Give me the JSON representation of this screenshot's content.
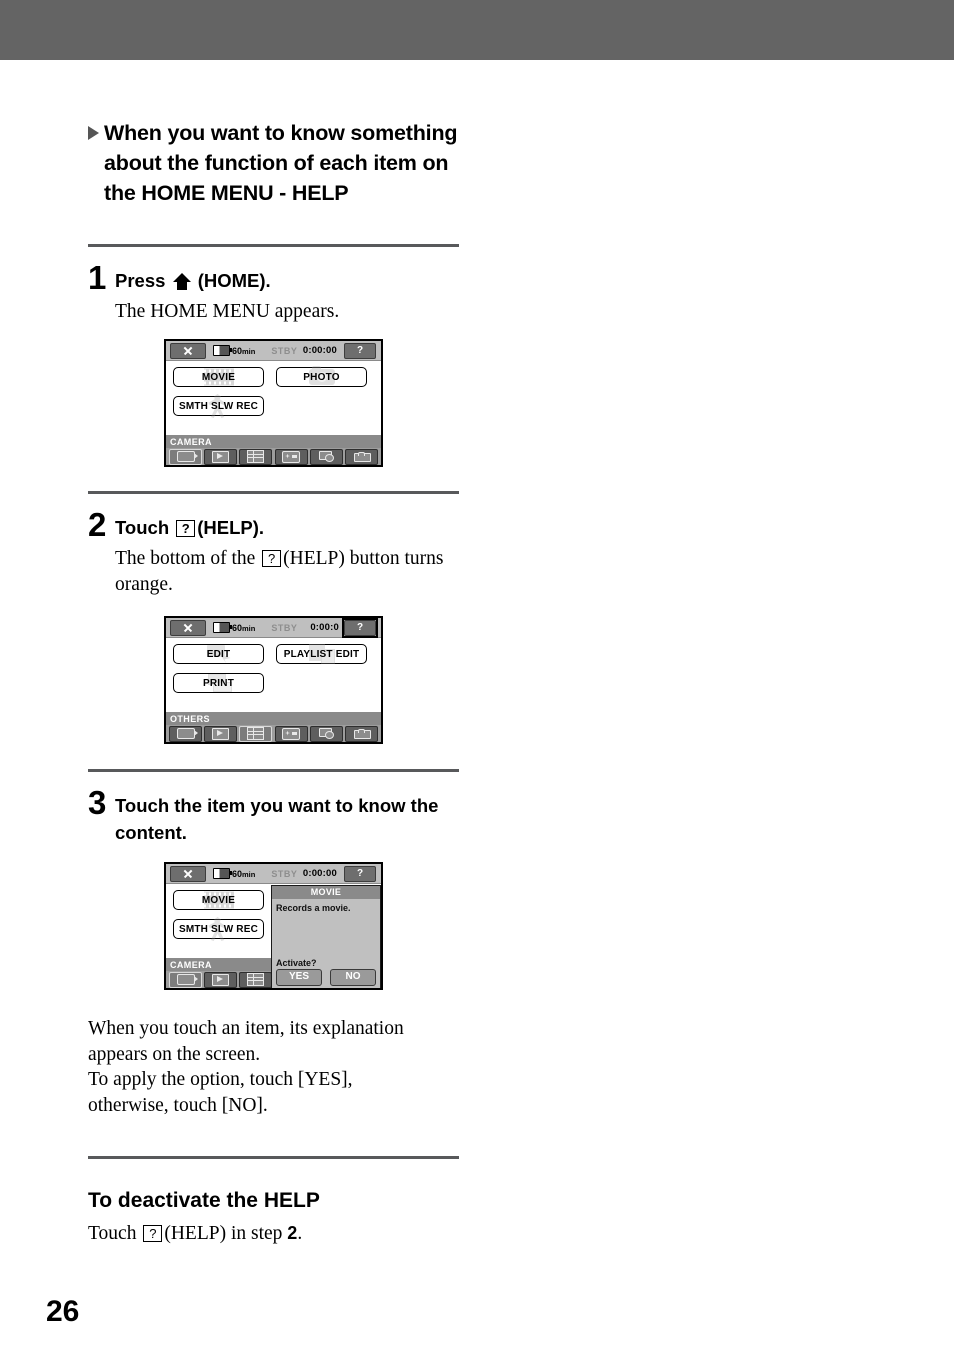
{
  "page": {
    "number": "26"
  },
  "section": {
    "heading": "When you want to know something about the function of each item on the HOME MENU - HELP"
  },
  "steps": [
    {
      "number": "1",
      "title_before": "Press",
      "title_after": "(HOME).",
      "icon": "home-icon",
      "subtext": "The HOME MENU appears."
    },
    {
      "number": "2",
      "title_before": "Touch",
      "title_after": "(HELP).",
      "icon": "help-icon",
      "subtext_before": "The bottom of the",
      "subtext_after": "(HELP) button turns orange."
    },
    {
      "number": "3",
      "title": "Touch the item you want to know the content."
    }
  ],
  "screens": {
    "screen1": {
      "status": {
        "close": "close-icon",
        "battery_icon": "battery-icon",
        "battery_value": "60",
        "battery_unit": "min",
        "mode": "STBY",
        "timecode": "0:00:00",
        "help": "?"
      },
      "options": [
        {
          "label": "MOVIE",
          "ghost": "film-icon"
        },
        {
          "label": "PHOTO",
          "ghost": "camera-icon"
        },
        {
          "label": "SMTH SLW REC",
          "ghost": "person-icon"
        }
      ],
      "category": "CAMERA",
      "tabs": [
        {
          "name": "camera-tab",
          "icon": "camcorder-icon",
          "active": true
        },
        {
          "name": "view-images-tab",
          "icon": "play-icon",
          "active": false
        },
        {
          "name": "others-tab",
          "icon": "list-icon",
          "active": false
        },
        {
          "name": "manage-media-tab",
          "icon": "media-icon",
          "active": false
        },
        {
          "name": "edit-tab",
          "icon": "edit-icon",
          "active": false
        },
        {
          "name": "settings-tab",
          "icon": "toolbox-icon",
          "active": false
        }
      ]
    },
    "screen2": {
      "status": {
        "close": "close-icon",
        "battery_icon": "battery-icon",
        "battery_value": "60",
        "battery_unit": "min",
        "mode": "STBY",
        "timecode": "0:00:0",
        "help": "?",
        "help_highlighted": true
      },
      "options": [
        {
          "label": "EDIT",
          "ghost": "edit-icon"
        },
        {
          "label": "PLAYLIST EDIT",
          "ghost": "playlist-icon"
        },
        {
          "label": "PRINT",
          "ghost": "printer-icon"
        }
      ],
      "category": "OTHERS",
      "tabs": [
        {
          "name": "camera-tab",
          "icon": "camcorder-icon",
          "active": false
        },
        {
          "name": "view-images-tab",
          "icon": "play-icon",
          "active": false
        },
        {
          "name": "others-tab",
          "icon": "list-icon",
          "active": true
        },
        {
          "name": "manage-media-tab",
          "icon": "media-icon",
          "active": false
        },
        {
          "name": "edit-tab",
          "icon": "edit-icon",
          "active": false
        },
        {
          "name": "settings-tab",
          "icon": "toolbox-icon",
          "active": false
        }
      ]
    },
    "screen3": {
      "status": {
        "close": "close-icon",
        "battery_icon": "battery-icon",
        "battery_value": "60",
        "battery_unit": "min",
        "mode": "STBY",
        "timecode": "0:00:00",
        "help": "?"
      },
      "options": [
        {
          "label": "MOVIE",
          "ghost": "film-icon"
        },
        {
          "label": "SMTH SLW REC",
          "ghost": "person-icon"
        }
      ],
      "category": "CAMERA",
      "popup": {
        "title": "MOVIE",
        "description": "Records a movie.",
        "question": "Activate?",
        "yes": "YES",
        "no": "NO"
      },
      "tabs": [
        {
          "name": "camera-tab",
          "icon": "camcorder-icon",
          "active": true
        },
        {
          "name": "view-images-tab",
          "icon": "play-icon",
          "active": false
        },
        {
          "name": "others-tab",
          "icon": "list-icon",
          "active": false
        },
        {
          "name": "manage-media-tab",
          "icon": "media-icon",
          "active": false
        },
        {
          "name": "edit-tab",
          "icon": "edit-icon",
          "active": false
        },
        {
          "name": "settings-tab",
          "icon": "toolbox-icon",
          "active": false
        }
      ]
    }
  },
  "body_paragraph": {
    "line1": "When you touch an item, its explanation",
    "line2": "appears on the screen.",
    "line3": "To apply the option, touch [YES],",
    "line4": "otherwise, touch [NO]."
  },
  "deactivate": {
    "heading": "To deactivate the HELP",
    "text_before": "Touch",
    "text_middle": "(HELP) in step",
    "step_ref": "2",
    "text_end": "."
  }
}
